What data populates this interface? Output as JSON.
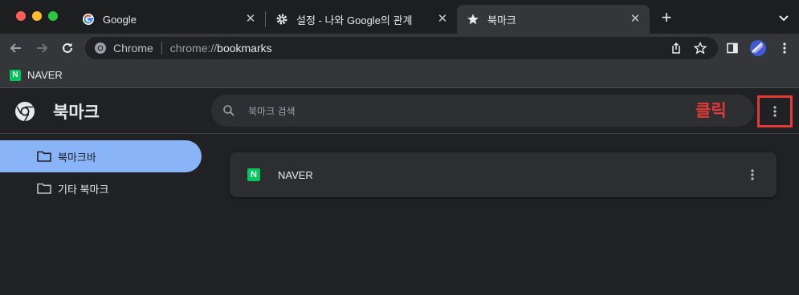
{
  "tabs": [
    {
      "title": "Google",
      "icon": "google-icon"
    },
    {
      "title": "설정 - 나와 Google의 관계",
      "icon": "gear-icon"
    },
    {
      "title": "북마크",
      "icon": "star-icon",
      "active": true
    }
  ],
  "toolbar": {
    "site_label": "Chrome",
    "url_scheme": "chrome://",
    "url_path": "bookmarks"
  },
  "bookmarks_bar": {
    "items": [
      {
        "label": "NAVER",
        "icon_letter": "N"
      }
    ]
  },
  "page": {
    "title": "북마크",
    "search_placeholder": "북마크 검색",
    "annotation": "클릭"
  },
  "sidebar": {
    "items": [
      {
        "label": "북마크바",
        "active": true
      },
      {
        "label": "기타 북마크",
        "active": false
      }
    ]
  },
  "bookmark_list": [
    {
      "title": "NAVER",
      "icon_letter": "N"
    }
  ],
  "colors": {
    "accent": "#8ab4f8",
    "naver_green": "#03c75a",
    "annotation_red": "#e53935"
  }
}
